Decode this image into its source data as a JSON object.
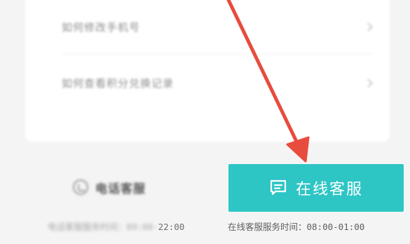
{
  "menu_rows": [
    {
      "label": "如何修改手机号"
    },
    {
      "label": "如何查看积分兑换记录"
    }
  ],
  "phone_service": {
    "label": "电话客服",
    "hours_prefix": "电话客服服务时间：09:00-",
    "hours_end": "22:00"
  },
  "online_service": {
    "button_label": "在线客服",
    "hours_label": "在线客服服务时间：",
    "hours": "08:00-01:00"
  },
  "colors": {
    "accent": "#2ec5c5",
    "annotation_arrow": "#e84c3d"
  },
  "icons": {
    "online_button": "chat-bubble-icon",
    "phone": "phone-icon",
    "row_chevron": "chevron-right-icon"
  }
}
